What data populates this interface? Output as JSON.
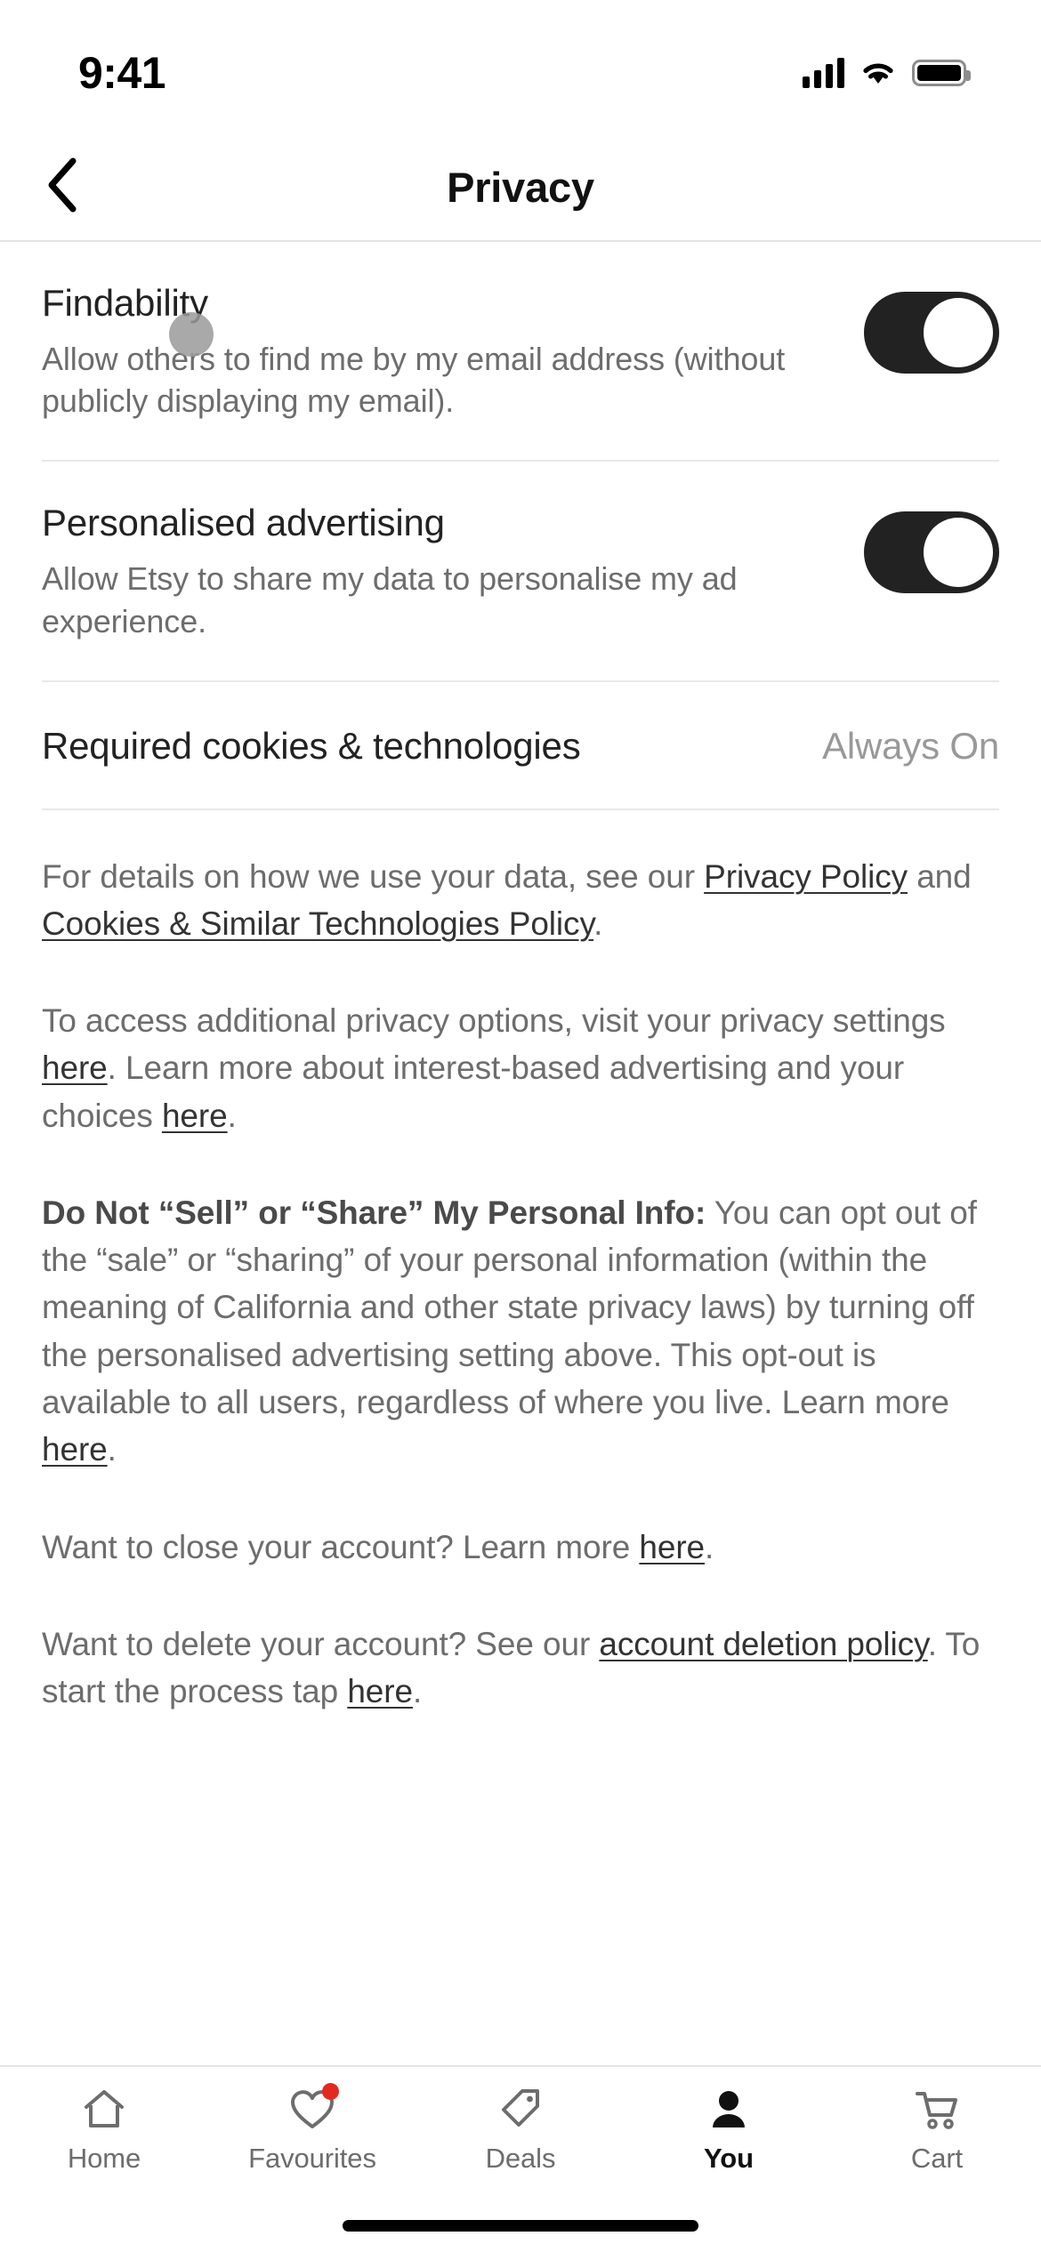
{
  "status_bar": {
    "time": "9:41",
    "cellular_icon": "signal-bars-icon",
    "wifi_icon": "wifi-icon",
    "battery_icon": "battery-full-icon"
  },
  "header": {
    "back_icon": "chevron-left-icon",
    "title": "Privacy"
  },
  "settings": [
    {
      "title": "Findability",
      "description": "Allow others to find me by my email address (without publicly displaying my email).",
      "toggle_state": "on"
    },
    {
      "title": "Personalised advertising",
      "description": "Allow Etsy to share my data to personalise my ad experience.",
      "toggle_state": "on"
    }
  ],
  "cookies_row": {
    "label": "Required cookies & technologies",
    "value": "Always On"
  },
  "legal": {
    "p1_a": "For details on how we use your data, see our ",
    "p1_link1": "Privacy Policy",
    "p1_b": " and ",
    "p1_link2": "Cookies & Similar Technologies Policy",
    "p1_c": ".",
    "p2_a": "To access additional privacy options, visit your privacy settings ",
    "p2_link1": "here",
    "p2_b": ". Learn more about interest-based advertising and your choices ",
    "p2_link2": "here",
    "p2_c": ".",
    "p3_bold": "Do Not “Sell” or “Share” My Personal Info:",
    "p3_a": " You can opt out of the “sale” or “sharing” of your personal information (within the meaning of California and other state privacy laws) by turning off the personalised advertising setting above. This opt-out is available to all users, regardless of where you live. Learn more ",
    "p3_link": "here",
    "p3_b": ".",
    "p4_a": "Want to close your account? Learn more ",
    "p4_link": "here",
    "p4_b": ".",
    "p5_a": "Want to delete your account? See our ",
    "p5_link1": "account deletion policy",
    "p5_b": ". To start the process tap ",
    "p5_link2": "here",
    "p5_c": "."
  },
  "tab_bar": [
    {
      "label": "Home",
      "icon": "home-icon",
      "active": false,
      "badge": false
    },
    {
      "label": "Favourites",
      "icon": "heart-icon",
      "active": false,
      "badge": true
    },
    {
      "label": "Deals",
      "icon": "tag-icon",
      "active": false,
      "badge": false
    },
    {
      "label": "You",
      "icon": "person-icon",
      "active": true,
      "badge": false
    },
    {
      "label": "Cart",
      "icon": "cart-icon",
      "active": false,
      "badge": false
    }
  ],
  "colors": {
    "toggle_on": "#222222",
    "badge": "#e4281f",
    "body_text": "#6d6d6d",
    "link_text": "#333333"
  }
}
